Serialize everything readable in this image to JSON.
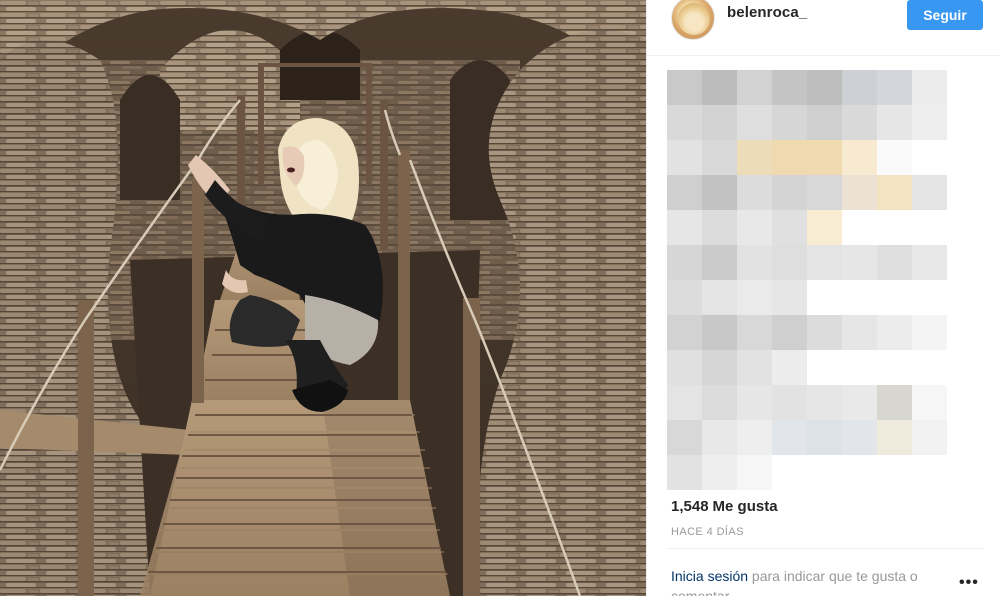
{
  "post": {
    "username": "belenroca_",
    "follow_label": "Seguir",
    "likes_count": "1,548",
    "likes_label": "Me gusta",
    "timestamp": "HACE 4 DÍAS",
    "login_link": "Inicia sesión",
    "login_rest": " para indicar que te gusta o comentar.",
    "more_label": "•••"
  },
  "icons": {
    "avatar": "avatar-image",
    "more": "more-options-icon"
  },
  "colors": {
    "follow_button": "#3897f0",
    "link": "#003569",
    "muted_text": "#999999",
    "primary_text": "#262626"
  }
}
